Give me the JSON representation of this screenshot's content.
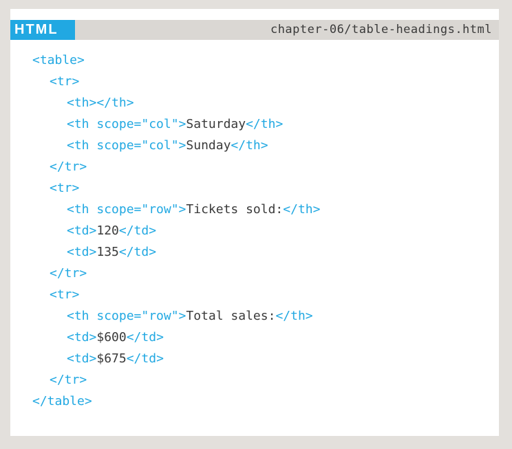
{
  "header": {
    "language_label": "HTML",
    "file_path": "chapter-06/table-headings.html"
  },
  "colors": {
    "page_background": "#e3e0dc",
    "panel_background": "#ffffff",
    "header_bar": "#dad7d3",
    "accent": "#21a8e2",
    "code_text": "#3a3a3a"
  },
  "code": {
    "lines": [
      {
        "indent": 0,
        "tokens": [
          {
            "type": "tag",
            "text": "<table>"
          }
        ]
      },
      {
        "indent": 1,
        "tokens": [
          {
            "type": "tag",
            "text": "<tr>"
          }
        ]
      },
      {
        "indent": 2,
        "tokens": [
          {
            "type": "tag",
            "text": "<th></th>"
          }
        ]
      },
      {
        "indent": 2,
        "tokens": [
          {
            "type": "tag",
            "text": "<th scope=\"col\">"
          },
          {
            "type": "text",
            "text": "Saturday"
          },
          {
            "type": "tag",
            "text": "</th>"
          }
        ]
      },
      {
        "indent": 2,
        "tokens": [
          {
            "type": "tag",
            "text": "<th scope=\"col\">"
          },
          {
            "type": "text",
            "text": "Sunday"
          },
          {
            "type": "tag",
            "text": "</th>"
          }
        ]
      },
      {
        "indent": 1,
        "tokens": [
          {
            "type": "tag",
            "text": "</tr>"
          }
        ]
      },
      {
        "indent": 1,
        "tokens": [
          {
            "type": "tag",
            "text": "<tr>"
          }
        ]
      },
      {
        "indent": 2,
        "tokens": [
          {
            "type": "tag",
            "text": "<th scope=\"row\">"
          },
          {
            "type": "text",
            "text": "Tickets sold:"
          },
          {
            "type": "tag",
            "text": "</th>"
          }
        ]
      },
      {
        "indent": 2,
        "tokens": [
          {
            "type": "tag",
            "text": "<td>"
          },
          {
            "type": "text",
            "text": "120"
          },
          {
            "type": "tag",
            "text": "</td>"
          }
        ]
      },
      {
        "indent": 2,
        "tokens": [
          {
            "type": "tag",
            "text": "<td>"
          },
          {
            "type": "text",
            "text": "135"
          },
          {
            "type": "tag",
            "text": "</td>"
          }
        ]
      },
      {
        "indent": 1,
        "tokens": [
          {
            "type": "tag",
            "text": "</tr>"
          }
        ]
      },
      {
        "indent": 1,
        "tokens": [
          {
            "type": "tag",
            "text": "<tr>"
          }
        ]
      },
      {
        "indent": 2,
        "tokens": [
          {
            "type": "tag",
            "text": "<th scope=\"row\">"
          },
          {
            "type": "text",
            "text": "Total sales:"
          },
          {
            "type": "tag",
            "text": "</th>"
          }
        ]
      },
      {
        "indent": 2,
        "tokens": [
          {
            "type": "tag",
            "text": "<td>"
          },
          {
            "type": "text",
            "text": "$600"
          },
          {
            "type": "tag",
            "text": "</td>"
          }
        ]
      },
      {
        "indent": 2,
        "tokens": [
          {
            "type": "tag",
            "text": "<td>"
          },
          {
            "type": "text",
            "text": "$675"
          },
          {
            "type": "tag",
            "text": "</td>"
          }
        ]
      },
      {
        "indent": 1,
        "tokens": [
          {
            "type": "tag",
            "text": "</tr>"
          }
        ]
      },
      {
        "indent": 0,
        "tokens": [
          {
            "type": "tag",
            "text": "</table>"
          }
        ]
      }
    ]
  }
}
